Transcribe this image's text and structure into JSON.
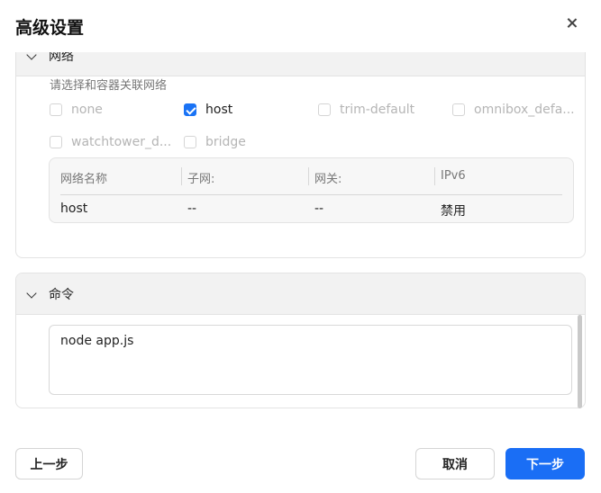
{
  "dialog": {
    "title": "高级设置"
  },
  "network": {
    "section_title": "网络",
    "hint": "请选择和容器关联网络",
    "options": [
      {
        "label": "none",
        "checked": false,
        "enabled": false
      },
      {
        "label": "host",
        "checked": true,
        "enabled": true
      },
      {
        "label": "trim-default",
        "checked": false,
        "enabled": false
      },
      {
        "label": "omnibox_defa...",
        "checked": false,
        "enabled": false
      },
      {
        "label": "watchtower_d...",
        "checked": false,
        "enabled": false
      },
      {
        "label": "bridge",
        "checked": false,
        "enabled": false
      }
    ],
    "table": {
      "headers": [
        "网络名称",
        "子网:",
        "网关:",
        "IPv6"
      ],
      "rows": [
        [
          "host",
          "--",
          "--",
          "禁用"
        ]
      ]
    }
  },
  "command": {
    "section_title": "命令",
    "value": "node app.js"
  },
  "footer": {
    "prev_label": "上一步",
    "cancel_label": "取消",
    "next_label": "下一步"
  },
  "colors": {
    "accent": "#1a6ef5",
    "checkbox_checked": "#1a73f5"
  }
}
